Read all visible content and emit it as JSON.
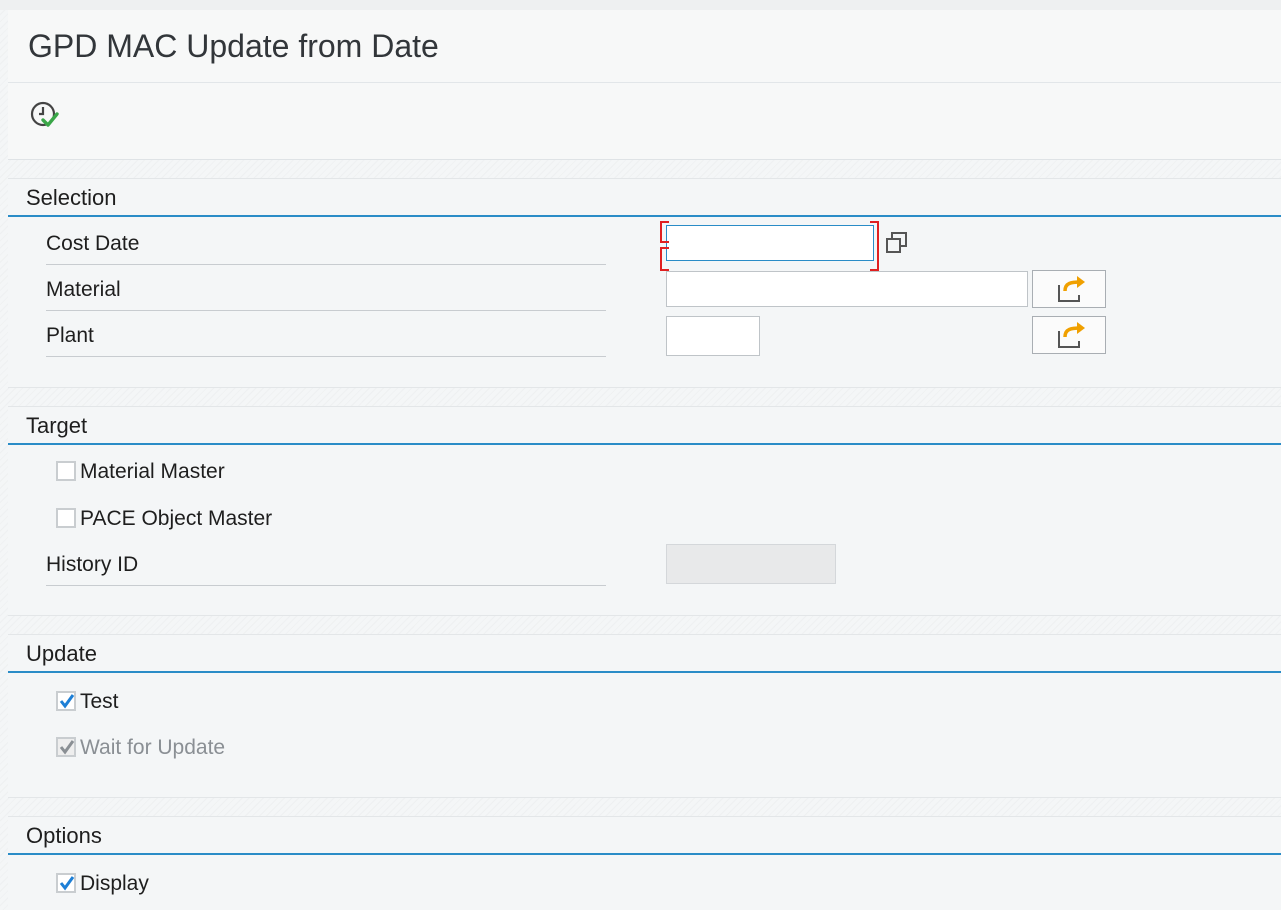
{
  "app": {
    "title": "GPD MAC Update from Date"
  },
  "toolbar": {
    "execute_icon": "execute-clock-check-icon"
  },
  "colors": {
    "accent": "#2a8cc7",
    "focus_marker": "#e02020",
    "check": "#1d7fd6",
    "multi_select_arrow": "#f0a000"
  },
  "selection": {
    "title": "Selection",
    "cost_date": {
      "label": "Cost Date",
      "value": "",
      "placeholder": ""
    },
    "material": {
      "label": "Material",
      "value": "",
      "placeholder": ""
    },
    "plant": {
      "label": "Plant",
      "value": "",
      "placeholder": ""
    }
  },
  "target": {
    "title": "Target",
    "material_master": {
      "label": "Material Master",
      "checked": false
    },
    "pace_object_master": {
      "label": "PACE Object Master",
      "checked": false
    },
    "history_id": {
      "label": "History ID",
      "value": ""
    }
  },
  "update": {
    "title": "Update",
    "test": {
      "label": "Test",
      "checked": true
    },
    "wait_for_update": {
      "label": "Wait for Update",
      "checked": true,
      "disabled": true
    }
  },
  "options": {
    "title": "Options",
    "display": {
      "label": "Display",
      "checked": true
    }
  }
}
